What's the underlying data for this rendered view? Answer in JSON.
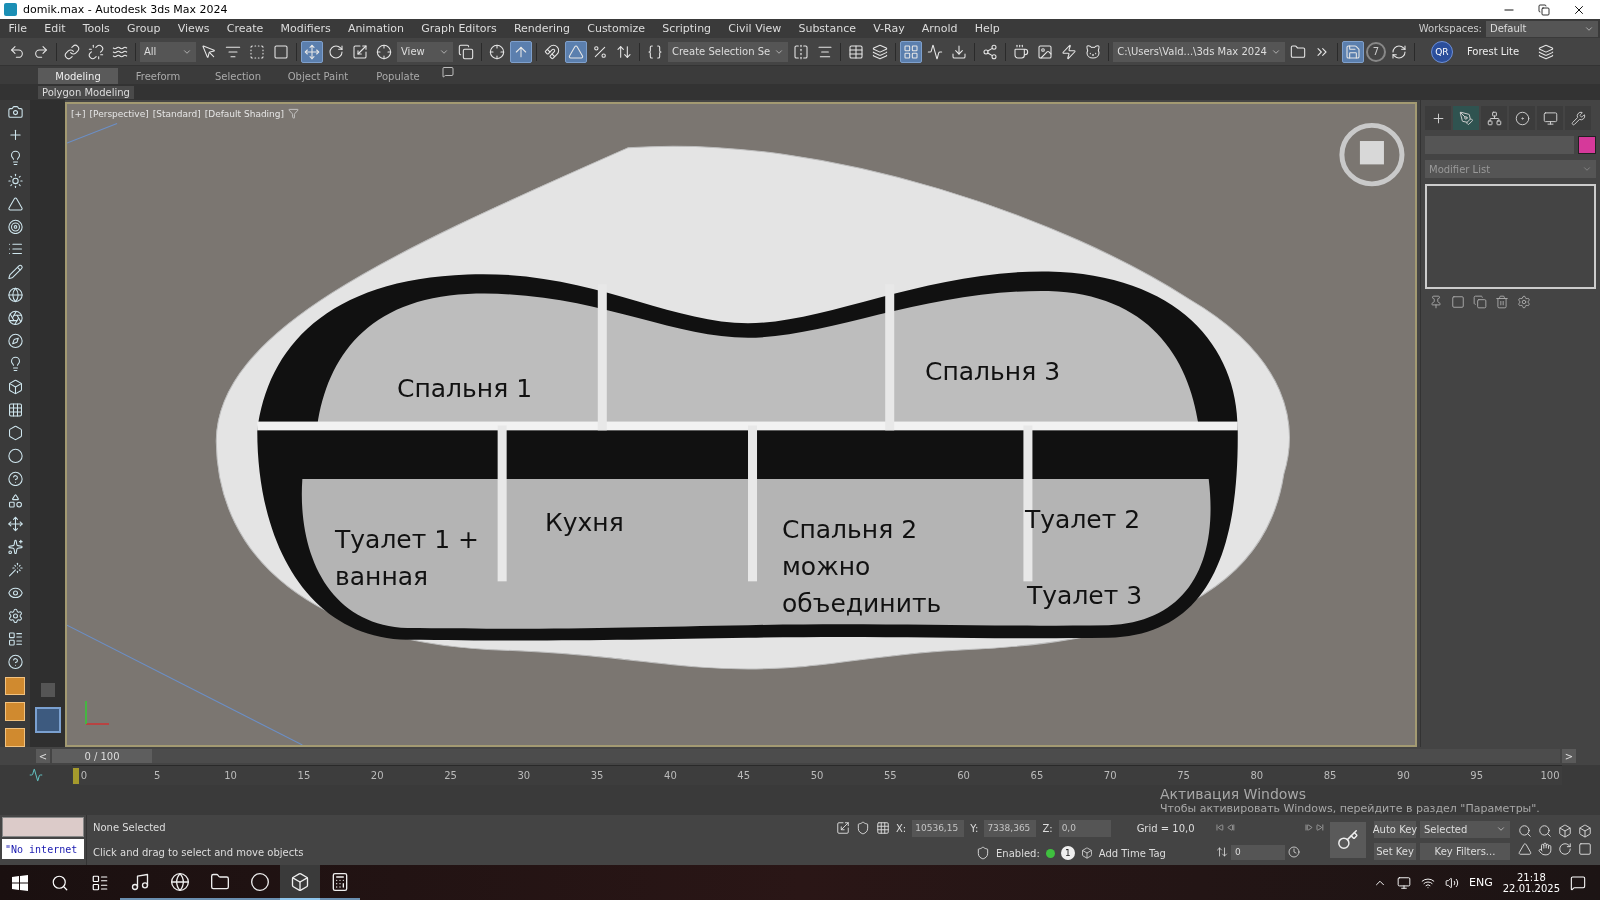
{
  "window": {
    "title": "domik.max - Autodesk 3ds Max 2024"
  },
  "menu": [
    "File",
    "Edit",
    "Tools",
    "Group",
    "Views",
    "Create",
    "Modifiers",
    "Animation",
    "Graph Editors",
    "Rendering",
    "Customize",
    "Scripting",
    "Civil View",
    "Substance",
    "V-Ray",
    "Arnold",
    "Help"
  ],
  "workspaces": {
    "label": "Workspaces:",
    "value": "Default"
  },
  "toolbar": {
    "selection_filter": "All",
    "reference_coord": "View",
    "named_selection": "Create Selection Se",
    "project_path": "C:\\Users\\Vald...\\3ds Max 2024",
    "backup_count": "7",
    "qr_badge": "QR",
    "plugin_label": "Forest Lite",
    "buttons": [
      {
        "active": false
      },
      {
        "active": false
      },
      {
        "active": false
      },
      {
        "active": false
      },
      {
        "active": false
      },
      {
        "active": false
      },
      {
        "active": false
      },
      {
        "active": false
      },
      {
        "active": false
      },
      {
        "active": true
      },
      {
        "active": false
      },
      {
        "active": false
      },
      {
        "active": false
      },
      {
        "active": false
      },
      {
        "active": false
      },
      {
        "active": true
      },
      {
        "active": false
      },
      {
        "active": true
      },
      {
        "active": false
      },
      {
        "active": false
      },
      {
        "active": false
      },
      {
        "active": false
      },
      {
        "active": false
      },
      {
        "active": false
      },
      {
        "active": false
      },
      {
        "active": true
      },
      {
        "active": false
      },
      {
        "active": false
      },
      {
        "active": false
      },
      {
        "active": false
      },
      {
        "active": false
      },
      {
        "active": false
      },
      {
        "active": false
      },
      {
        "active": false
      },
      {
        "active": false
      },
      {
        "active": true
      },
      {
        "active": false
      },
      {
        "active": false
      }
    ]
  },
  "ribbon": {
    "tabs": [
      {
        "label": "Modeling",
        "selected": true
      },
      {
        "label": "Freeform",
        "selected": false
      },
      {
        "label": "Selection",
        "selected": false
      },
      {
        "label": "Object Paint",
        "selected": false
      },
      {
        "label": "Populate",
        "selected": false
      }
    ],
    "panel": "Polygon Modeling"
  },
  "viewport": {
    "labels": [
      "[+]",
      "[Perspective]",
      "[Standard]",
      "[Default Shading]"
    ],
    "rooms": [
      {
        "lines": [
          "Спальня 1"
        ]
      },
      {
        "lines": [
          "Спальня 3"
        ]
      },
      {
        "lines": [
          "Туалет 1 +",
          "ванная"
        ]
      },
      {
        "lines": [
          "Кухня"
        ]
      },
      {
        "lines": [
          "Спальня 2",
          "можно",
          "объединить"
        ]
      },
      {
        "lines": [
          "Туалет 2"
        ]
      },
      {
        "lines": [
          "Туалет 3"
        ]
      }
    ]
  },
  "command_panel": {
    "tabs": [
      {
        "selected": false
      },
      {
        "selected": true
      },
      {
        "selected": false
      },
      {
        "selected": false
      },
      {
        "selected": false
      },
      {
        "selected": false
      }
    ],
    "color": "#d6399a",
    "modifier_list": "Modifier List"
  },
  "time_slider": {
    "prev": "<",
    "position": "0 / 100",
    "level": 0,
    "next": ">"
  },
  "track_bar": {
    "ticks": [
      "0",
      "5",
      "10",
      "15",
      "20",
      "25",
      "30",
      "35",
      "40",
      "45",
      "50",
      "55",
      "60",
      "65",
      "70",
      "75",
      "80",
      "85",
      "90",
      "95",
      "100"
    ]
  },
  "status": {
    "listener": "\"No internet",
    "selection": "None Selected",
    "prompt": "Click and drag to select and move objects",
    "coords": [
      {
        "label": "X:",
        "value": "10536,15"
      },
      {
        "label": "Y:",
        "value": "7338,365"
      },
      {
        "label": "Z:",
        "value": "0,0"
      }
    ],
    "grid": "Grid = 10,0",
    "enabled_label": "Enabled:",
    "enabled_count": "1",
    "time_tag": "Add Time Tag",
    "frame": "0",
    "auto_key": "Auto Key",
    "set_key": "Set Key",
    "key_mode": "Selected",
    "key_filters": "Key Filters..."
  },
  "activation": {
    "title": "Активация Windows",
    "text": "Чтобы активировать Windows, перейдите в раздел \"Параметры\"."
  },
  "taskbar": {
    "apps": [
      {
        "selected": false
      },
      {
        "selected": false
      },
      {
        "selected": false
      },
      {
        "selected": false
      },
      {
        "selected": true
      },
      {
        "selected": false
      }
    ],
    "lang": "ENG",
    "time": "21:18",
    "date": "22.01.2025"
  }
}
